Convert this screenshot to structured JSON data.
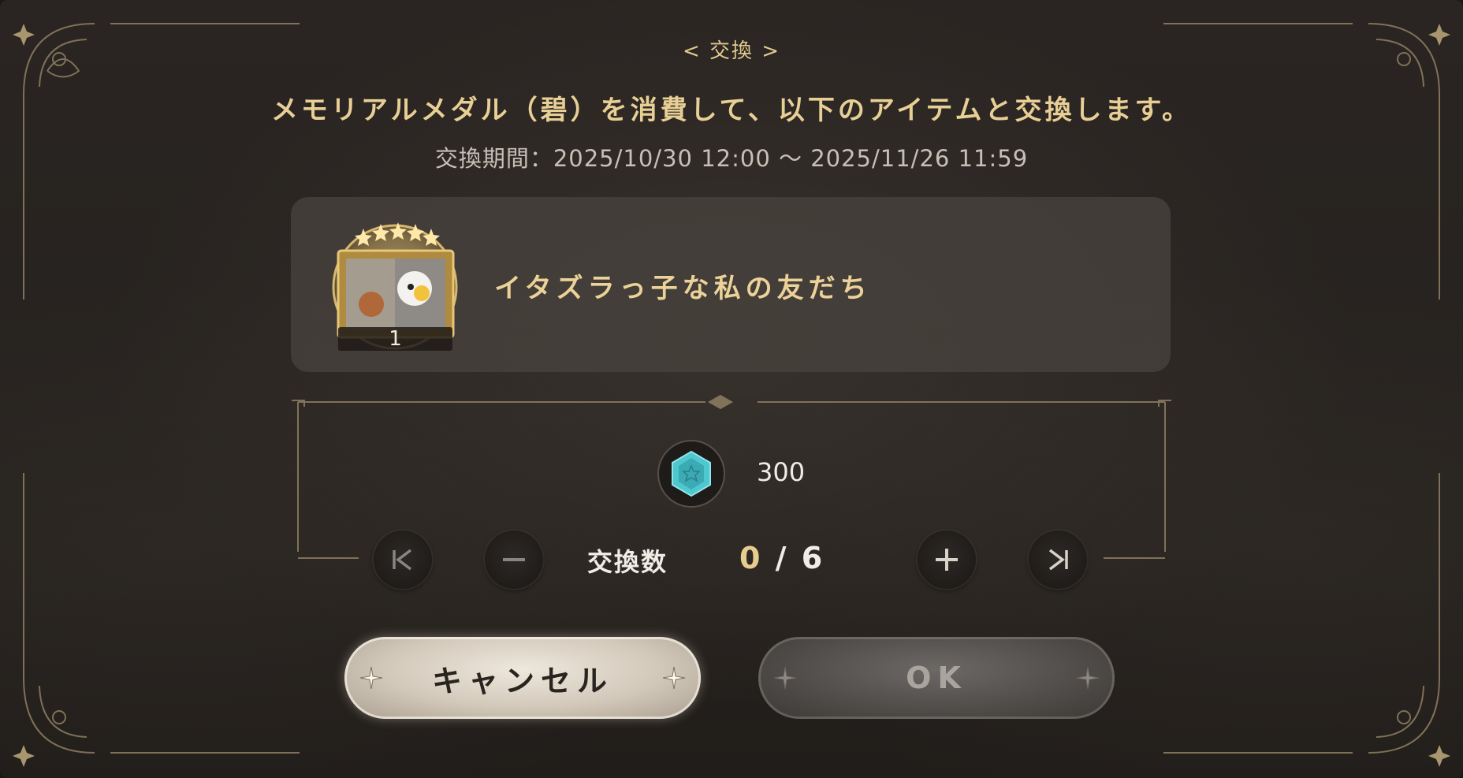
{
  "dialog": {
    "header": "< 交換 >",
    "description": "メモリアルメダル（碧）を消費して、以下のアイテムと交換します。",
    "period": "交換期間：2025/10/30 12:00 ～ 2025/11/26 11:59"
  },
  "item": {
    "name": "イタズラっ子な私の友だち",
    "count": "1",
    "icon": "framed-picture-icon"
  },
  "cost": {
    "currency_icon": "memorial-medal-blue-icon",
    "amount": "300"
  },
  "quantity": {
    "label": "交換数",
    "current": "0",
    "separator": " / ",
    "max": "6"
  },
  "buttons": {
    "cancel": "キャンセル",
    "ok": "OK"
  },
  "colors": {
    "accent_gold": "#e8cf95",
    "medal_teal": "#4fc7cf",
    "panel": "#26221f"
  }
}
